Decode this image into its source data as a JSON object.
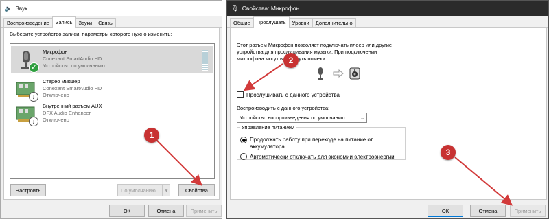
{
  "sound_window": {
    "title": "Звук",
    "tabs": [
      "Воспроизведение",
      "Запись",
      "Звуки",
      "Связь"
    ],
    "active_tab": "Запись",
    "instruction": "Выберите устройство записи, параметры которого нужно изменить:",
    "devices": [
      {
        "name": "Микрофон",
        "driver": "Conexant SmartAudio HD",
        "status": "Устройство по умолчанию",
        "selected": true,
        "icon": "microphone-icon"
      },
      {
        "name": "Стерео микшер",
        "driver": "Conexant SmartAudio HD",
        "status": "Отключено",
        "selected": false,
        "icon": "sound-card-icon"
      },
      {
        "name": "Внутренний разъем  AUX",
        "driver": "DFX Audio Enhancer",
        "status": "Отключено",
        "selected": false,
        "icon": "sound-card-icon"
      }
    ],
    "configure_label": "Настроить",
    "default_label": "По умолчанию",
    "properties_label": "Свойства",
    "ok_label": "ОК",
    "cancel_label": "Отмена",
    "apply_label": "Применить"
  },
  "props_window": {
    "title": "Свойства: Микрофон",
    "tabs": [
      "Общие",
      "Прослушать",
      "Уровни",
      "Дополнительно"
    ],
    "active_tab": "Прослушать",
    "description": "Этот разъем Микрофон позволяет подключать плеер или другие устройства для прослушивания музыки. При подключении микрофона могут возникнуть помехи.",
    "listen_checkbox_label": "Прослушивать с данного устройства",
    "listen_checked": false,
    "playback_label": "Воспроизводить с данного устройства:",
    "playback_value": "Устройство воспроизведения по умолчанию",
    "power_group_label": "Управление питанием",
    "power_options": [
      "Продолжать работу при переходе на питание от аккумулятора",
      "Автоматически отключать для экономии электроэнергии"
    ],
    "power_selected": 0,
    "ok_label": "ОК",
    "cancel_label": "Отмена",
    "apply_label": "Применить"
  },
  "markers": [
    "1",
    "2",
    "3"
  ],
  "colors": {
    "marker": "#c83232",
    "accent": "#0078d7",
    "selection": "#d9d9d9",
    "check": "#2e9e3e"
  }
}
